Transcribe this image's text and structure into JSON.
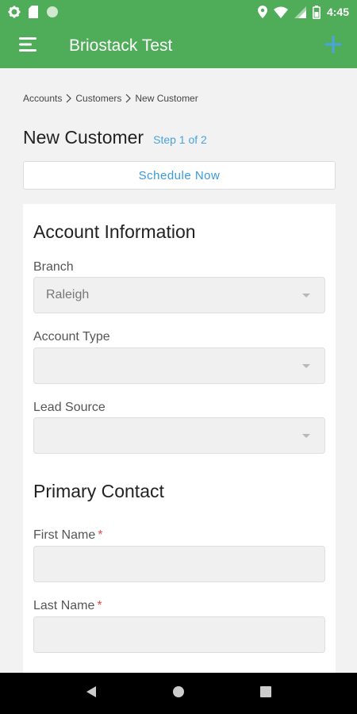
{
  "status_bar": {
    "time": "4:45"
  },
  "app_bar": {
    "title": "Briostack Test"
  },
  "breadcrumb": [
    "Accounts",
    "Customers",
    "New Customer"
  ],
  "page": {
    "title": "New Customer",
    "step": "Step 1 of 2"
  },
  "schedule_button": "Schedule Now",
  "account_info": {
    "title": "Account Information",
    "branch": {
      "label": "Branch",
      "value": "Raleigh"
    },
    "account_type": {
      "label": "Account Type",
      "value": ""
    },
    "lead_source": {
      "label": "Lead Source",
      "value": ""
    }
  },
  "primary_contact": {
    "title": "Primary Contact",
    "first_name": {
      "label": "First Name",
      "required_mark": "*",
      "value": ""
    },
    "last_name": {
      "label": "Last Name",
      "required_mark": "*",
      "value": ""
    }
  },
  "colors": {
    "brand": "#4fac58",
    "accent": "#4aa3df",
    "required": "#e14b4b"
  },
  "icons": [
    "settings-icon",
    "sd-card-icon",
    "circle-icon",
    "location-icon",
    "wifi-icon",
    "signal-icon",
    "battery-icon",
    "menu-icon",
    "add-icon",
    "back-icon",
    "home-icon",
    "recents-icon"
  ]
}
